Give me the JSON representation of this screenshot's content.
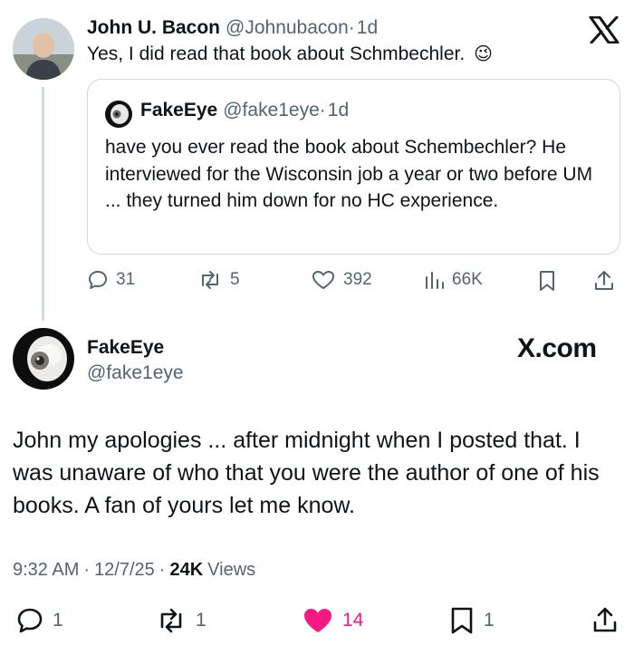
{
  "reply_tweet": {
    "author_name": "John U. Bacon",
    "handle": "@Johnubacon",
    "separator": "·",
    "time": "1d",
    "text": "Yes, I did read that book about Schmbechler.",
    "emoji": "😉",
    "quote": {
      "author_name": "FakeEye",
      "handle": "@fake1eye",
      "separator": "·",
      "time": "1d",
      "text": "have you ever read the book about Schembechler? He interviewed for the Wisconsin job a year or two before UM ... they turned him down for no HC experience."
    },
    "stats": {
      "replies": "31",
      "reposts": "5",
      "likes": "392",
      "views": "66K"
    }
  },
  "main_tweet": {
    "author_name": "FakeEye",
    "handle": "@fake1eye",
    "brand": "X.com",
    "text": "John my apologies ... after midnight when I posted that. I was unaware of who that you were the author of one of his books. A fan of yours let me know.",
    "time": "9:32 AM",
    "date": "12/7/25",
    "separator": "·",
    "views_count": "24K",
    "views_label": "Views",
    "stats": {
      "replies": "1",
      "reposts": "1",
      "likes": "14",
      "bookmarks": "1"
    },
    "like_color": "#f91880"
  }
}
